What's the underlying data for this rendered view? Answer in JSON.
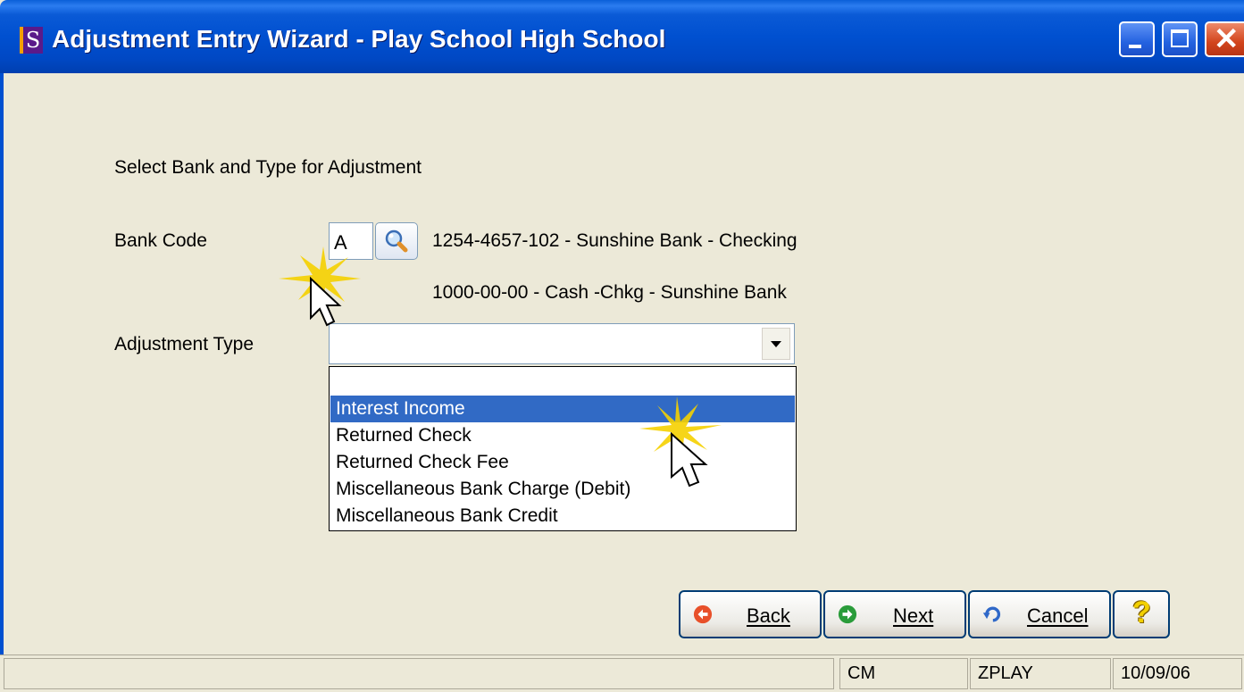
{
  "window": {
    "app_icon_letter": "S",
    "title": "Adjustment Entry Wizard - Play School High School"
  },
  "content": {
    "heading": "Select Bank and Type for Adjustment",
    "bank_code_label": "Bank Code",
    "bank_code_value": "A",
    "bank_description": "1254-4657-102 - Sunshine Bank - Checking",
    "gl_account_description": "1000-00-00 - Cash -Chkg - Sunshine Bank",
    "adjustment_type_label": "Adjustment Type",
    "adjustment_type_value": ""
  },
  "dropdown": {
    "options": [
      "",
      "Interest Income",
      "Returned Check",
      "Returned Check Fee",
      "Miscellaneous Bank Charge (Debit)",
      "Miscellaneous Bank Credit"
    ],
    "highlighted_option": "Interest Income"
  },
  "buttons": {
    "back": "Back",
    "next": "Next",
    "cancel": "Cancel",
    "help": "?"
  },
  "statusbar": {
    "module": "CM",
    "company": "ZPLAY",
    "date": "10/09/06"
  },
  "icons": {
    "app": "app-icon",
    "lookup": "magnifier-icon",
    "back": "back-arrow-icon",
    "next": "next-arrow-icon",
    "cancel": "undo-icon",
    "help": "question-mark-icon"
  },
  "colors": {
    "titlebar": "#0050d0",
    "selection": "#316ac5",
    "window_bg": "#ece9d8"
  }
}
